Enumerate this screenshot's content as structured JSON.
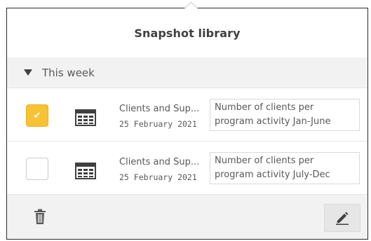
{
  "header": {
    "title": "Snapshot library"
  },
  "section": {
    "label": "This week",
    "expanded": true
  },
  "snapshots": [
    {
      "selected": true,
      "icon": "table-icon",
      "name": "Clients and Sup...",
      "date": "25 February 2021",
      "description_lines": [
        "Number of clients per",
        "program activity Jan-June"
      ]
    },
    {
      "selected": false,
      "icon": "table-icon",
      "name": "Clients and Sup...",
      "date": "25 February 2021",
      "description_lines": [
        "Number of clients per",
        "program activity July-Dec"
      ]
    }
  ],
  "footer": {
    "delete_icon": "trash-icon",
    "edit_icon": "pencil-icon"
  },
  "colors": {
    "accent": "#f7c234",
    "panel_bg": "#f2f2f2",
    "text": "#404040"
  }
}
